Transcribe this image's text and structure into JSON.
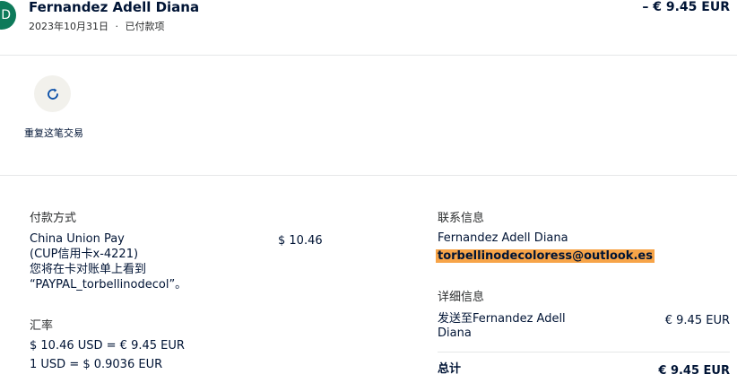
{
  "header": {
    "avatar_initial": "D",
    "merchant_name": "Fernandez Adell Diana",
    "date": "2023年10月31日",
    "separator": "·",
    "status": "已付款项",
    "amount": "– € 9.45 EUR"
  },
  "actions": {
    "repeat_label": "重复这笔交易",
    "repeat_icon": "refresh-icon"
  },
  "payment": {
    "title": "付款方式",
    "method_line1": "China Union Pay",
    "method_line2": "(CUP信用卡x-4221)",
    "note_line1": "您将在卡对账单上看到",
    "note_line2": "“PAYPAL_torbellinodecol”。",
    "amount": "$ 10.46"
  },
  "exchange": {
    "title": "汇率",
    "line1": "$ 10.46 USD = € 9.45 EUR",
    "line2": "1 USD = $ 0.9036 EUR"
  },
  "contact": {
    "title": "联系信息",
    "name": "Fernandez Adell Diana",
    "email": "torbellinodecoloress@outlook.es"
  },
  "details": {
    "title": "详细信息",
    "sent_to_line1": "发送至Fernandez Adell",
    "sent_to_line2": "Diana",
    "sent_amount": "€ 9.45 EUR",
    "total_label": "总计",
    "total_amount": "€ 9.45 EUR"
  },
  "colors": {
    "primary_text": "#001435",
    "avatar_bg": "#0e7a5a",
    "highlight": "#f7a448",
    "button_bg": "#f2f1ec",
    "divider": "#e6e7e8"
  }
}
